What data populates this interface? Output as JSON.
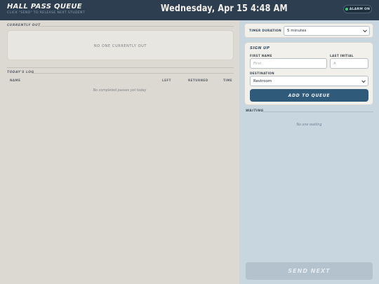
{
  "header": {
    "title": "HALL PASS QUEUE",
    "subtitle": "CLICK \"SEND\" TO RELEASE NEXT STUDENT",
    "datetime": "Wednesday, Apr 15 4:48 AM",
    "alarm_label": "ALARM ON",
    "alarm_status_color": "#3ecf7a"
  },
  "currently_out": {
    "label": "CURRENTLY OUT",
    "empty_text": "NO ONE CURRENTLY OUT"
  },
  "todays_log": {
    "label": "TODAY'S LOG",
    "columns": [
      "NAME",
      "LEFT",
      "RETURNED",
      "TIME"
    ],
    "rows": [],
    "empty_text": "No completed passes yet today"
  },
  "timer": {
    "label": "TIMER DURATION",
    "selected": "5 minutes"
  },
  "signup": {
    "title": "SIGN UP",
    "first_name_label": "FIRST NAME",
    "first_name_placeholder": "First",
    "first_name_value": "",
    "last_initial_label": "LAST INITIAL",
    "last_initial_placeholder": "A",
    "last_initial_value": "",
    "destination_label": "DESTINATION",
    "destination_selected": "Restroom",
    "add_button": "ADD TO QUEUE"
  },
  "waiting": {
    "label": "WAITING",
    "empty_text": "No one waiting"
  },
  "send_button": "SEND NEXT",
  "colors": {
    "header_bg": "#2c3e50",
    "left_bg": "#dcd9d2",
    "right_bg": "#c8d6e0",
    "primary_button": "#2f5a7a",
    "disabled_button": "#b3c2cd"
  }
}
